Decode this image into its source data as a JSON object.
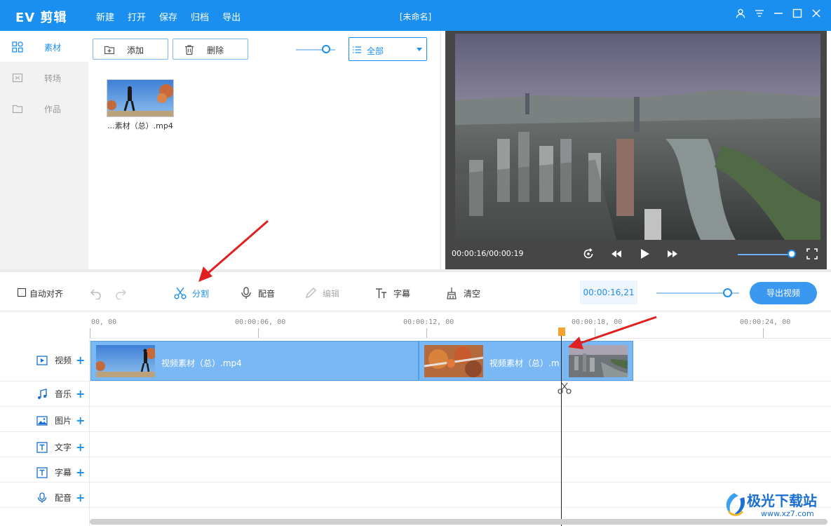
{
  "app": {
    "logo": "EV 剪辑",
    "doc_title": "[未命名]"
  },
  "menu": [
    "新建",
    "打开",
    "保存",
    "归档",
    "导出"
  ],
  "sidebar": {
    "items": [
      {
        "label": "素材",
        "active": true
      },
      {
        "label": "转场",
        "active": false
      },
      {
        "label": "作品",
        "active": false
      }
    ]
  },
  "media": {
    "add_label": "添加",
    "delete_label": "删除",
    "filter_value": "全部",
    "items": [
      {
        "name": "...素材（总）.mp4"
      }
    ]
  },
  "preview": {
    "time": "00:00:16/00:00:19"
  },
  "toolbar": {
    "auto_align": "自动对齐",
    "split": "分割",
    "dub": "配音",
    "edit": "编辑",
    "caption": "字幕",
    "clear": "清空",
    "timecode": "00:00:16,21",
    "export": "导出视频"
  },
  "ruler": {
    "labels": [
      "00, 00",
      "00:00:06, 00",
      "00:00:12, 00",
      "00:00:18, 00",
      "00:00:24, 00"
    ]
  },
  "tracks": [
    {
      "label": "视频"
    },
    {
      "label": "音乐"
    },
    {
      "label": "图片"
    },
    {
      "label": "文字"
    },
    {
      "label": "字幕"
    },
    {
      "label": "配音"
    }
  ],
  "clips": [
    {
      "name": "视频素材（总）.mp4"
    },
    {
      "name": "视频素材（总）.m"
    }
  ],
  "watermark": {
    "text": "极光下载站",
    "url": "www.xz7.com"
  },
  "colors": {
    "accent": "#1b8ff0",
    "clip": "#7ab8f5",
    "playhead_marker": "#f3a331",
    "annotation_arrow": "#e02020"
  }
}
